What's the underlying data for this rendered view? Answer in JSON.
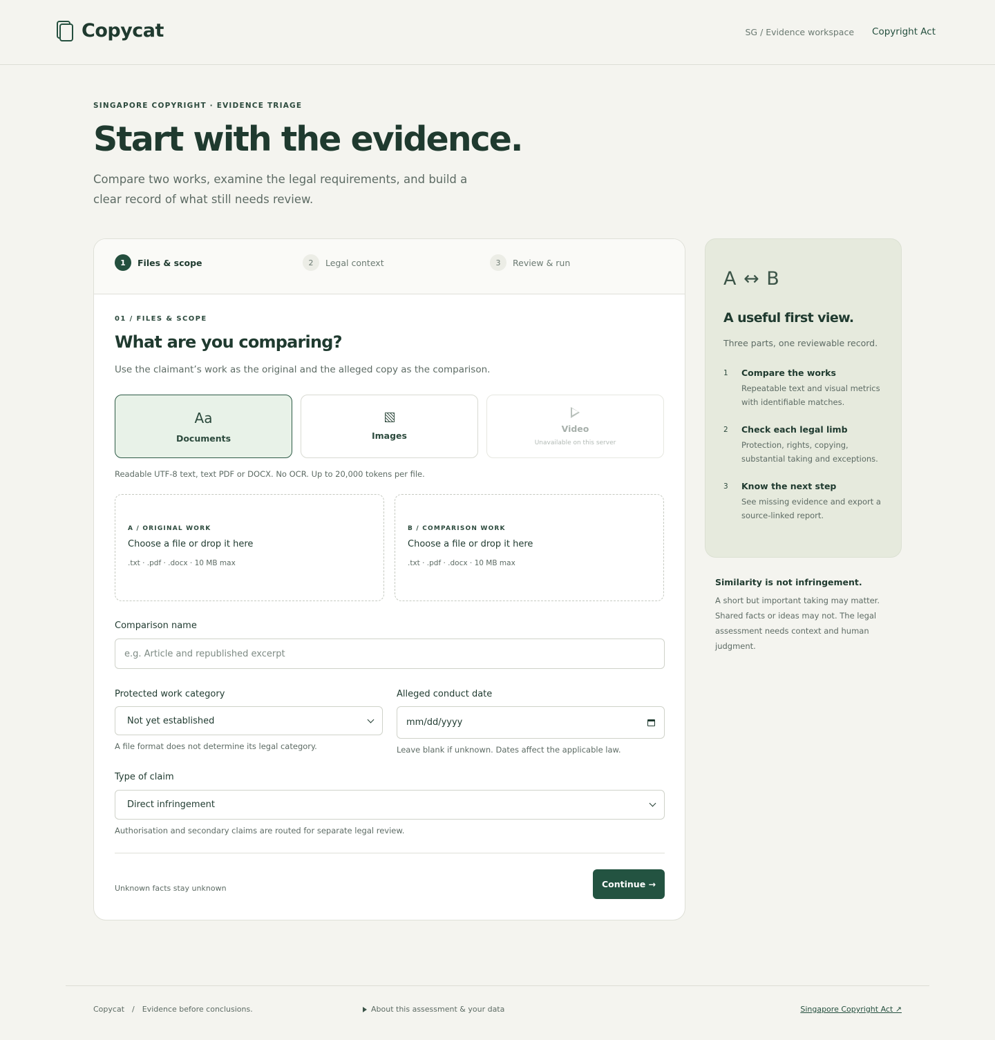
{
  "brand": {
    "name": "Copycat"
  },
  "header": {
    "workspace": "SG / Evidence workspace",
    "link": "Copyright Act"
  },
  "hero": {
    "eyebrow": "SINGAPORE COPYRIGHT · EVIDENCE TRIAGE",
    "title": "Start with the evidence.",
    "subtitle": "Compare two works, examine the legal requirements, and build a clear record of what still needs review."
  },
  "steps": [
    {
      "num": "1",
      "label": "Files & scope"
    },
    {
      "num": "2",
      "label": "Legal context"
    },
    {
      "num": "3",
      "label": "Review & run"
    }
  ],
  "form": {
    "eyebrow": "01 / FILES & SCOPE",
    "title": "What are you comparing?",
    "subtitle": "Use the claimant’s work as the original and the alleged copy as the comparison.",
    "types": {
      "documents": {
        "glyph": "Aa",
        "label": "Documents"
      },
      "images": {
        "label": "Images"
      },
      "video": {
        "label": "Video",
        "note": "Unavailable on this server"
      }
    },
    "types_help": "Readable UTF-8 text, text PDF or DOCX. No OCR. Up to 20,000 tokens per file.",
    "drop_a": {
      "eyebrow": "A / ORIGINAL WORK",
      "title": "Choose a file or drop it here",
      "formats": ".txt · .pdf · .docx · 10 MB max"
    },
    "drop_b": {
      "eyebrow": "B / COMPARISON WORK",
      "title": "Choose a file or drop it here",
      "formats": ".txt · .pdf · .docx · 10 MB max"
    },
    "comparison_name": {
      "label": "Comparison name",
      "placeholder": "e.g. Article and republished excerpt"
    },
    "category": {
      "label": "Protected work category",
      "value": "Not yet established",
      "help": "A file format does not determine its legal category."
    },
    "date": {
      "label": "Alleged conduct date",
      "value": "mm/dd/yyyy",
      "help": "Leave blank if unknown. Dates affect the applicable law."
    },
    "claim": {
      "label": "Type of claim",
      "value": "Direct infringement",
      "help": "Authorisation and secondary claims are routed for separate legal review."
    },
    "footer_note": "Unknown facts stay unknown",
    "continue_label": "Continue →"
  },
  "aside": {
    "ab": "A ↔ B",
    "title": "A useful first view.",
    "subtitle": "Three parts, one reviewable record.",
    "items": [
      {
        "num": "1",
        "title": "Compare the works",
        "desc": "Repeatable text and visual metrics with identifiable matches."
      },
      {
        "num": "2",
        "title": "Check each legal limb",
        "desc": "Protection, rights, copying, substantial taking and exceptions."
      },
      {
        "num": "3",
        "title": "Know the next step",
        "desc": "See missing evidence and export a source-linked report."
      }
    ]
  },
  "note": {
    "title": "Similarity is not infringement.",
    "body": "A short but important taking may matter. Shared facts or ideas may not. The legal assessment needs context and human judgment."
  },
  "footer": {
    "brand": "Copycat",
    "sep": "/",
    "tagline": "Evidence before conclusions.",
    "about": "About this assessment & your data",
    "link": "Singapore Copyright Act ↗"
  }
}
